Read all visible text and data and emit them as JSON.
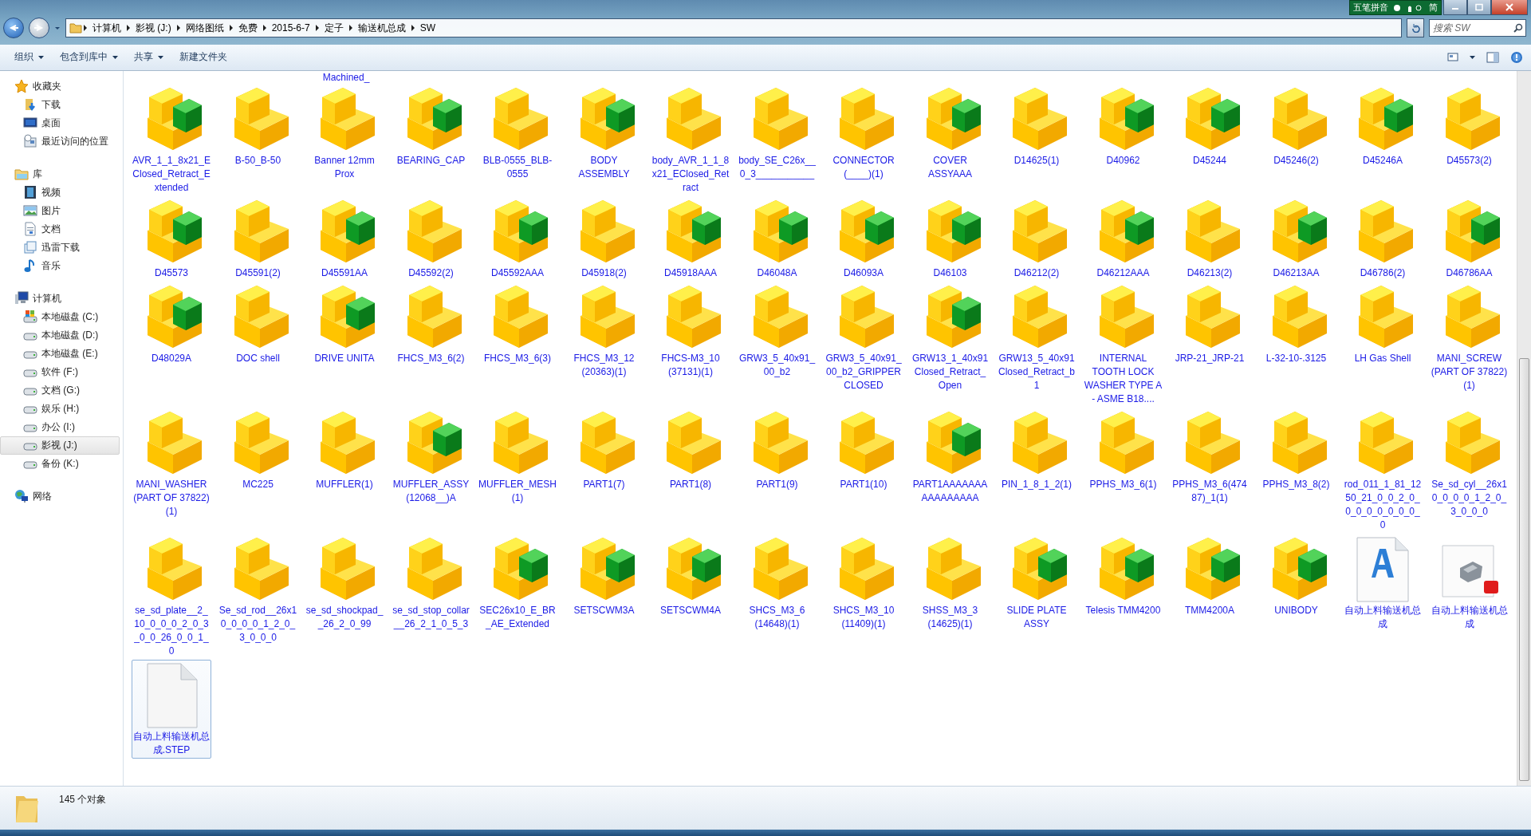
{
  "address_bar": {
    "crumbs": [
      "计算机",
      "影视 (J:)",
      "网络图纸",
      "免费",
      "2015-6-7",
      "定子",
      "输送机总成",
      "SW"
    ]
  },
  "search": {
    "placeholder": "搜索 SW"
  },
  "ime_bar": {
    "title": "五笔拼音",
    "mode": "简"
  },
  "toolbar": {
    "buttons": [
      {
        "label": "组织",
        "dropdown": true
      },
      {
        "label": "包含到库中",
        "dropdown": true
      },
      {
        "label": "共享",
        "dropdown": true
      },
      {
        "label": "新建文件夹",
        "dropdown": false
      }
    ]
  },
  "sidebar": {
    "groups": [
      {
        "label": "收藏夹",
        "kind": "favorites",
        "items": [
          {
            "label": "下载",
            "kind": "downloads",
            "selected": false
          },
          {
            "label": "桌面",
            "kind": "desktop",
            "selected": false
          },
          {
            "label": "最近访问的位置",
            "kind": "recent",
            "selected": false
          }
        ]
      },
      {
        "label": "库",
        "kind": "library",
        "items": [
          {
            "label": "视频",
            "kind": "video",
            "selected": false
          },
          {
            "label": "图片",
            "kind": "picture",
            "selected": false
          },
          {
            "label": "文档",
            "kind": "document",
            "selected": false
          },
          {
            "label": "迅雷下载",
            "kind": "download-folder",
            "selected": false
          },
          {
            "label": "音乐",
            "kind": "music",
            "selected": false
          }
        ]
      },
      {
        "label": "计算机",
        "kind": "computer",
        "items": [
          {
            "label": "本地磁盘 (C:)",
            "kind": "system-drive",
            "selected": false
          },
          {
            "label": "本地磁盘 (D:)",
            "kind": "drive",
            "selected": false
          },
          {
            "label": "本地磁盘 (E:)",
            "kind": "drive",
            "selected": false
          },
          {
            "label": "软件 (F:)",
            "kind": "drive",
            "selected": false
          },
          {
            "label": "文档 (G:)",
            "kind": "drive",
            "selected": false
          },
          {
            "label": "娱乐 (H:)",
            "kind": "drive",
            "selected": false
          },
          {
            "label": "办公 (I:)",
            "kind": "drive",
            "selected": false
          },
          {
            "label": "影视 (J:)",
            "kind": "drive",
            "selected": true
          },
          {
            "label": "备份 (K:)",
            "kind": "drive",
            "selected": false
          }
        ]
      },
      {
        "label": "网络",
        "kind": "network"
      }
    ]
  },
  "files": {
    "cut_label": "Machined_",
    "items": [
      {
        "name": "AVR_1_1_8x21_EClosed_Retract_Extended",
        "kind": "assembly",
        "selected": false
      },
      {
        "name": "B-50_B-50",
        "kind": "part",
        "selected": false
      },
      {
        "name": "Banner 12mm Prox",
        "kind": "part",
        "selected": false
      },
      {
        "name": "BEARING_CAP",
        "kind": "assembly",
        "selected": false
      },
      {
        "name": "BLB-0555_BLB-0555",
        "kind": "part",
        "selected": false
      },
      {
        "name": "BODY ASSEMBLY",
        "kind": "assembly",
        "selected": false
      },
      {
        "name": "body_AVR_1_1_8x21_EClosed_Retract",
        "kind": "part",
        "selected": false
      },
      {
        "name": "body_SE_C26x__0_3___________",
        "kind": "part",
        "selected": false
      },
      {
        "name": "CONNECTOR (____)(1)",
        "kind": "part",
        "selected": false
      },
      {
        "name": "COVER ASSYAAA",
        "kind": "assembly",
        "selected": false
      },
      {
        "name": "D14625(1)",
        "kind": "part",
        "selected": false
      },
      {
        "name": "D40962",
        "kind": "assembly",
        "selected": false
      },
      {
        "name": "D45244",
        "kind": "assembly",
        "selected": false
      },
      {
        "name": "D45246(2)",
        "kind": "part",
        "selected": false
      },
      {
        "name": "D45246A",
        "kind": "assembly",
        "selected": false
      },
      {
        "name": "D45573(2)",
        "kind": "part",
        "selected": false
      },
      {
        "name": "D45573",
        "kind": "assembly",
        "selected": false
      },
      {
        "name": "D45591(2)",
        "kind": "part",
        "selected": false
      },
      {
        "name": "D45591AA",
        "kind": "assembly",
        "selected": false
      },
      {
        "name": "D45592(2)",
        "kind": "part",
        "selected": false
      },
      {
        "name": "D45592AAA",
        "kind": "assembly",
        "selected": false
      },
      {
        "name": "D45918(2)",
        "kind": "part",
        "selected": false
      },
      {
        "name": "D45918AAA",
        "kind": "assembly",
        "selected": false
      },
      {
        "name": "D46048A",
        "kind": "assembly",
        "selected": false
      },
      {
        "name": "D46093A",
        "kind": "assembly",
        "selected": false
      },
      {
        "name": "D46103",
        "kind": "assembly",
        "selected": false
      },
      {
        "name": "D46212(2)",
        "kind": "part",
        "selected": false
      },
      {
        "name": "D46212AAA",
        "kind": "assembly",
        "selected": false
      },
      {
        "name": "D46213(2)",
        "kind": "part",
        "selected": false
      },
      {
        "name": "D46213AA",
        "kind": "assembly",
        "selected": false
      },
      {
        "name": "D46786(2)",
        "kind": "part",
        "selected": false
      },
      {
        "name": "D46786AA",
        "kind": "assembly",
        "selected": false
      },
      {
        "name": "D48029A",
        "kind": "assembly",
        "selected": false
      },
      {
        "name": "DOC shell",
        "kind": "part",
        "selected": false
      },
      {
        "name": "DRIVE UNITA",
        "kind": "assembly",
        "selected": false
      },
      {
        "name": "FHCS_M3_6(2)",
        "kind": "part",
        "selected": false
      },
      {
        "name": "FHCS_M3_6(3)",
        "kind": "part",
        "selected": false
      },
      {
        "name": "FHCS_M3_12 (20363)(1)",
        "kind": "part",
        "selected": false
      },
      {
        "name": "FHCS-M3_10 (37131)(1)",
        "kind": "part",
        "selected": false
      },
      {
        "name": "GRW3_5_40x91_00_b2",
        "kind": "part",
        "selected": false
      },
      {
        "name": "GRW3_5_40x91_00_b2_GRIPPER CLOSED",
        "kind": "part",
        "selected": false
      },
      {
        "name": "GRW13_1_40x91Closed_Retract_Open",
        "kind": "assembly",
        "selected": false
      },
      {
        "name": "GRW13_5_40x91Closed_Retract_b1",
        "kind": "part",
        "selected": false
      },
      {
        "name": "INTERNAL TOOTH LOCK WASHER TYPE A - ASME B18....",
        "kind": "part",
        "selected": false
      },
      {
        "name": "JRP-21_JRP-21",
        "kind": "part",
        "selected": false
      },
      {
        "name": "L-32-10-.3125",
        "kind": "part",
        "selected": false
      },
      {
        "name": "LH Gas Shell",
        "kind": "part",
        "selected": false
      },
      {
        "name": "MANI_SCREW (PART OF 37822)(1)",
        "kind": "part",
        "selected": false
      },
      {
        "name": "MANI_WASHER (PART OF 37822)(1)",
        "kind": "part",
        "selected": false
      },
      {
        "name": "MC225",
        "kind": "part",
        "selected": false
      },
      {
        "name": "MUFFLER(1)",
        "kind": "part",
        "selected": false
      },
      {
        "name": "MUFFLER_ASSY (12068__)A",
        "kind": "assembly",
        "selected": false
      },
      {
        "name": "MUFFLER_MESH(1)",
        "kind": "part",
        "selected": false
      },
      {
        "name": "PART1(7)",
        "kind": "part",
        "selected": false
      },
      {
        "name": "PART1(8)",
        "kind": "part",
        "selected": false
      },
      {
        "name": "PART1(9)",
        "kind": "part",
        "selected": false
      },
      {
        "name": "PART1(10)",
        "kind": "part",
        "selected": false
      },
      {
        "name": "PART1AAAAAAAAAAAAAAAA",
        "kind": "assembly",
        "selected": false
      },
      {
        "name": "PIN_1_8_1_2(1)",
        "kind": "part",
        "selected": false
      },
      {
        "name": "PPHS_M3_6(1)",
        "kind": "part",
        "selected": false
      },
      {
        "name": "PPHS_M3_6(47487)_1(1)",
        "kind": "part",
        "selected": false
      },
      {
        "name": "PPHS_M3_8(2)",
        "kind": "part",
        "selected": false
      },
      {
        "name": "rod_011_1_81_1250_21_0_0_2_0_0_0_0_0_0_0_0_0",
        "kind": "part",
        "selected": false
      },
      {
        "name": "Se_sd_cyl__26x10_0_0_0_1_2_0_3_0_0_0",
        "kind": "part",
        "selected": false
      },
      {
        "name": "se_sd_plate__2_10_0_0_0_2_0_3_0_0_26_0_0_1_0",
        "kind": "part",
        "selected": false
      },
      {
        "name": "Se_sd_rod__26x10_0_0_0_1_2_0_3_0_0_0",
        "kind": "part",
        "selected": false
      },
      {
        "name": "se_sd_shockpad__26_2_0_99",
        "kind": "part",
        "selected": false
      },
      {
        "name": "se_sd_stop_collar__26_2_1_0_5_3",
        "kind": "part",
        "selected": false
      },
      {
        "name": "SEC26x10_E_BR_AE_Extended",
        "kind": "assembly",
        "selected": false
      },
      {
        "name": "SETSCWM3A",
        "kind": "assembly",
        "selected": false
      },
      {
        "name": "SETSCWM4A",
        "kind": "assembly",
        "selected": false
      },
      {
        "name": "SHCS_M3_6 (14648)(1)",
        "kind": "part",
        "selected": false
      },
      {
        "name": "SHCS_M3_10 (11409)(1)",
        "kind": "part",
        "selected": false
      },
      {
        "name": "SHSS_M3_3 (14625)(1)",
        "kind": "part",
        "selected": false
      },
      {
        "name": "SLIDE PLATE ASSY",
        "kind": "assembly",
        "selected": false
      },
      {
        "name": "Telesis TMM4200",
        "kind": "assembly",
        "selected": false
      },
      {
        "name": "TMM4200A",
        "kind": "assembly",
        "selected": false
      },
      {
        "name": "UNIBODY",
        "kind": "assembly",
        "selected": false
      },
      {
        "name": "自动上料输送机总成",
        "kind": "document",
        "selected": false
      },
      {
        "name": "自动上料输送机总成",
        "kind": "drawing",
        "selected": false
      },
      {
        "name": "自动上料输送机总成.STEP",
        "kind": "file",
        "selected": true
      }
    ]
  },
  "status_bar": {
    "count": "145 个对象"
  }
}
